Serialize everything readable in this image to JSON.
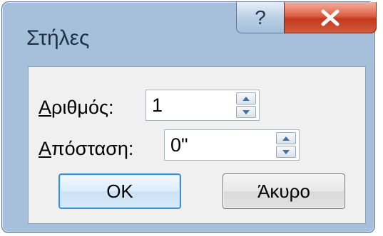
{
  "window": {
    "title": "Στήλες",
    "help_label": "?"
  },
  "fields": {
    "number": {
      "label_accel": "Α",
      "label_rest": "ριθμός:",
      "value": "1"
    },
    "spacing": {
      "label_accel": "Α",
      "label_rest": "πόσταση:",
      "value": "0\""
    }
  },
  "buttons": {
    "ok": "OK",
    "cancel": "Άκυρο"
  },
  "icons": {
    "help": "question-icon",
    "close": "close-icon",
    "up": "triangle-up-icon",
    "down": "triangle-down-icon"
  }
}
